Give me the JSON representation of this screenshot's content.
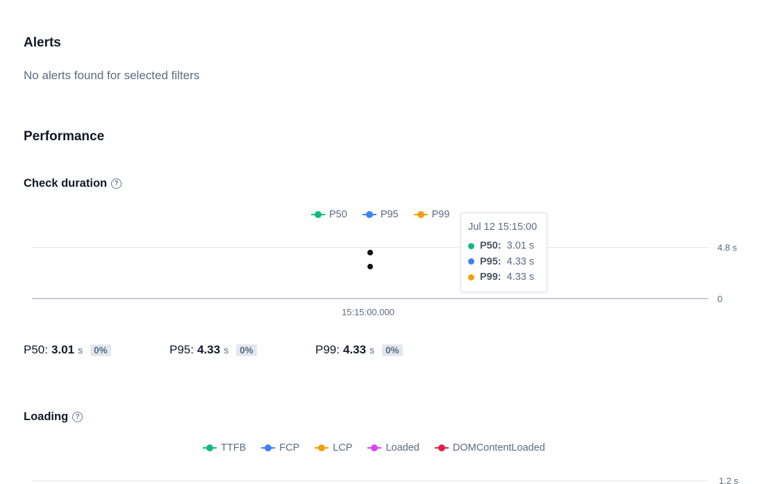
{
  "alerts": {
    "title": "Alerts",
    "empty_message": "No alerts found for selected filters"
  },
  "performance": {
    "title": "Performance"
  },
  "check_duration": {
    "title": "Check duration",
    "help_icon": "?",
    "legend": [
      {
        "name": "P50",
        "color": "#10b981"
      },
      {
        "name": "P95",
        "color": "#3b82f6"
      },
      {
        "name": "P99",
        "color": "#f59e0b"
      }
    ],
    "tooltip": {
      "date": "Jul 12 15:15:00",
      "rows": [
        {
          "label": "P50:",
          "value": "3.01 s",
          "color": "#10b981"
        },
        {
          "label": "P95:",
          "value": "4.33 s",
          "color": "#3b82f6"
        },
        {
          "label": "P99:",
          "value": "4.33 s",
          "color": "#f59e0b"
        }
      ]
    },
    "stats": [
      {
        "label": "P50:",
        "value": "3.01",
        "unit": "s",
        "change": "0%"
      },
      {
        "label": "P95:",
        "value": "4.33",
        "unit": "s",
        "change": "0%"
      },
      {
        "label": "P99:",
        "value": "4.33",
        "unit": "s",
        "change": "0%"
      }
    ]
  },
  "chart_data": [
    {
      "type": "scatter",
      "title": "Check duration",
      "x": [
        "15:15:00.000"
      ],
      "series": [
        {
          "name": "P50",
          "values": [
            3.01
          ]
        },
        {
          "name": "P95",
          "values": [
            4.33
          ]
        },
        {
          "name": "P99",
          "values": [
            4.33
          ]
        }
      ],
      "ytick_labels": [
        "4.8 s",
        "0"
      ],
      "ylim": [
        0,
        4.8
      ],
      "grid": true,
      "legend_position": "top-center"
    },
    {
      "type": "line",
      "title": "Loading",
      "series": [
        {
          "name": "TTFB"
        },
        {
          "name": "FCP"
        },
        {
          "name": "LCP"
        },
        {
          "name": "Loaded"
        },
        {
          "name": "DOMContentLoaded"
        }
      ],
      "ytick_labels": [
        "1.2 s"
      ],
      "grid": true,
      "legend_position": "top-center"
    }
  ],
  "loading": {
    "title": "Loading",
    "help_icon": "?",
    "legend": [
      {
        "name": "TTFB",
        "color": "#10b981"
      },
      {
        "name": "FCP",
        "color": "#3b82f6"
      },
      {
        "name": "LCP",
        "color": "#f59e0b"
      },
      {
        "name": "Loaded",
        "color": "#d946ef"
      },
      {
        "name": "DOMContentLoaded",
        "color": "#e11d48"
      }
    ]
  }
}
